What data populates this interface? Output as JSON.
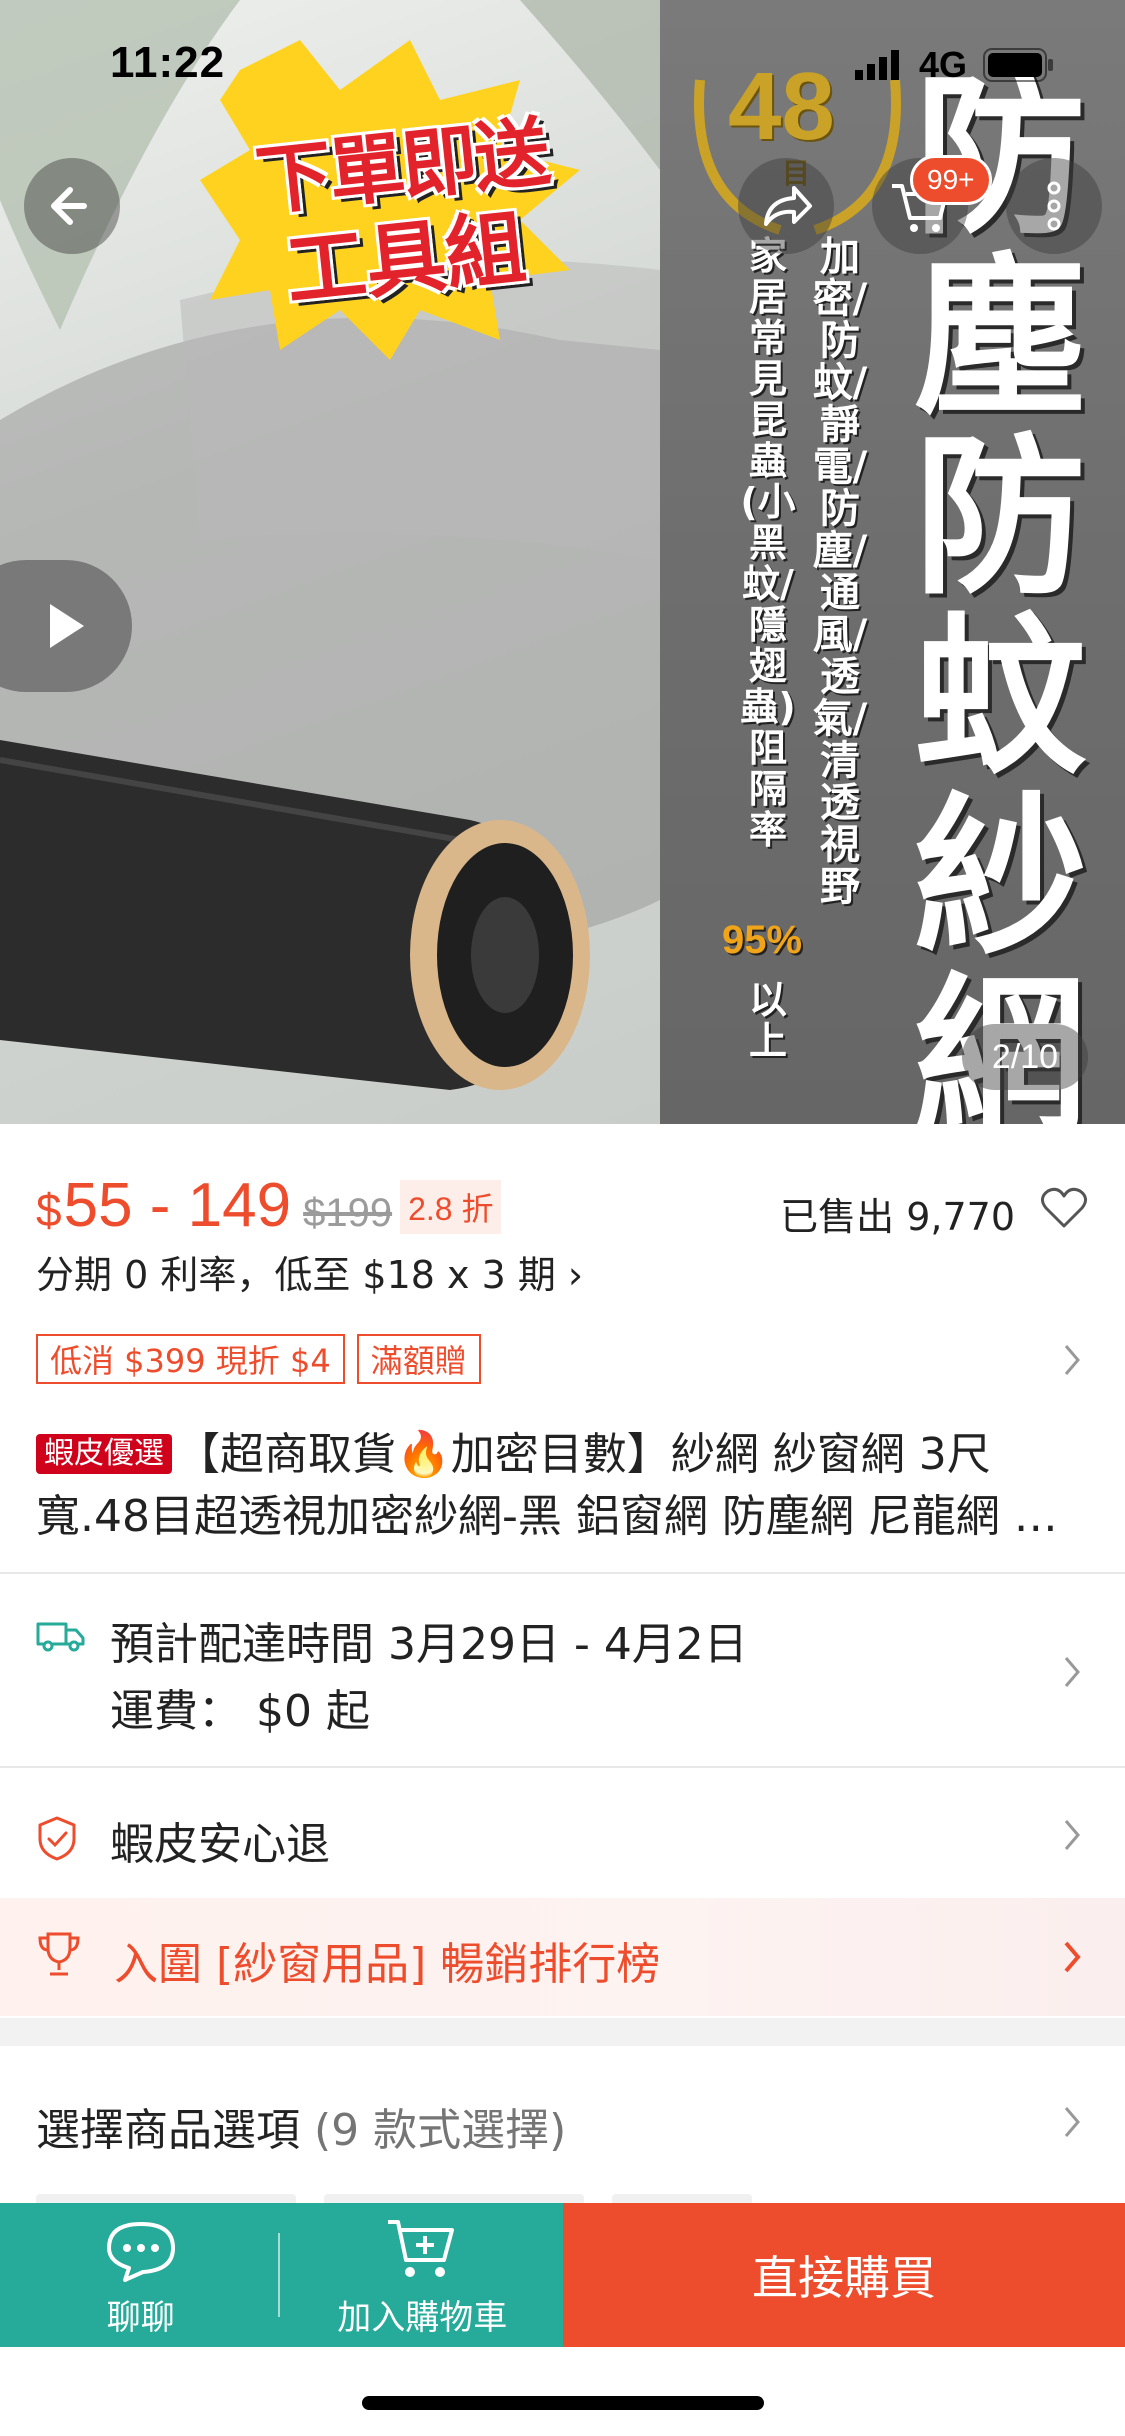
{
  "status_bar": {
    "time": "11:22",
    "network": "4G"
  },
  "hero": {
    "promo_line1": "下單即送",
    "promo_line2": "工具組",
    "mesh_count": "48",
    "mesh_unit": "目",
    "big_title": "防塵防蚊紗網",
    "feature_line_a": "加密/防蚊/靜電/防塵/通風/透氣/清透視野",
    "feature_line_b": "家居常見昆蟲(小黑蚊/隱翅蟲)阻隔率",
    "feature_pct": "95%",
    "feature_line_c": "以上",
    "cart_badge": "99+",
    "page_indicator": "2/10"
  },
  "price": {
    "currency": "$",
    "range": "55 - 149",
    "original": "$199",
    "discount": "2.8 折",
    "sold": "已售出 9,770",
    "installment": "分期 0 利率，低至 $18 x 3 期 ›"
  },
  "promos": [
    "低消 $399 現折 $4",
    "滿額贈"
  ],
  "product": {
    "badge": "蝦皮優選",
    "title": "【超商取貨🔥加密目數】紗網 紗窗網 3尺寬.48目超透視加密紗網-黑 鋁窗網 防塵網 尼龍網 防蚊紗網"
  },
  "shipping": {
    "line1": "預計配達時間 3月29日 - 4月2日",
    "line2": "運費： $0 起"
  },
  "guarantee": {
    "label": "蝦皮安心退"
  },
  "ranking": {
    "label": "入圍 [紗窗用品] 暢銷排行榜"
  },
  "options": {
    "label": "選擇商品選項",
    "count": "(9 款式選擇)"
  },
  "bottom_bar": {
    "chat": "聊聊",
    "add_cart": "加入購物車",
    "buy_now": "直接購買"
  },
  "colors": {
    "accent": "#ee4d2d",
    "teal": "#26aa99"
  },
  "icons": [
    "back-arrow-icon",
    "share-icon",
    "cart-icon",
    "more-icon",
    "play-icon",
    "heart-icon",
    "truck-icon",
    "shield-check-icon",
    "trophy-icon",
    "chevron-right-icon",
    "chat-icon",
    "add-cart-icon"
  ]
}
